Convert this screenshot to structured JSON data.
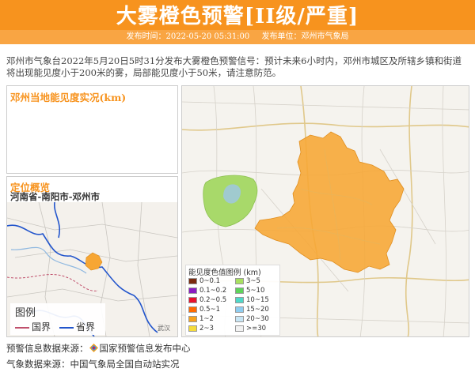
{
  "header": {
    "title": "大雾橙色预警[II级/严重]",
    "issue_time": "发布时间：2022-05-20 05:31:00",
    "issuer": "发布单位：邓州市气象局"
  },
  "notice": "邓州市气象台2022年5月20日5时31分发布大雾橙色预警信号：预计未来6小时内，邓州市城区及所辖乡镇和街道将出现能见度小于200米的雾，局部能见度小于50米，请注意防范。",
  "visibility_panel": {
    "title": "邓州当地能见度实况(km)"
  },
  "location_panel": {
    "title": "定位概览",
    "path": "河南省-南阳市-邓州市",
    "map_label": "武汉",
    "legend": {
      "title": "图例",
      "items": [
        {
          "label": "国界",
          "color": "#c0506c"
        },
        {
          "label": "省界",
          "color": "#2255cc"
        }
      ]
    }
  },
  "visibility_legend": {
    "title": "能见度色值图例 (km)",
    "items": [
      {
        "label": "0~0.1",
        "color": "#7b2a0e"
      },
      {
        "label": "0.1~0.2",
        "color": "#8a1cc2"
      },
      {
        "label": "0.2~0.5",
        "color": "#e8112d"
      },
      {
        "label": "0.5~1",
        "color": "#ff6a00"
      },
      {
        "label": "1~2",
        "color": "#f7a21b"
      },
      {
        "label": "2~3",
        "color": "#f5dc3b"
      },
      {
        "label": "3~5",
        "color": "#a8e060"
      },
      {
        "label": "5~10",
        "color": "#5fd35b"
      },
      {
        "label": "10~15",
        "color": "#4fd8c8"
      },
      {
        "label": "15~20",
        "color": "#8ecdf0"
      },
      {
        "label": "20~30",
        "color": "#c8e6f5"
      },
      {
        "label": ">=30",
        "color": "#f2f2f2"
      }
    ]
  },
  "map_colors": {
    "warning_area": "#f7a633",
    "lake": "#a8d96a"
  },
  "footer": {
    "warning_source_label": "预警信息数据来源：",
    "warning_source": "国家预警信息发布中心",
    "weather_source_label": "气象数据来源：",
    "weather_source": "中国气象局全国自动站实况"
  }
}
